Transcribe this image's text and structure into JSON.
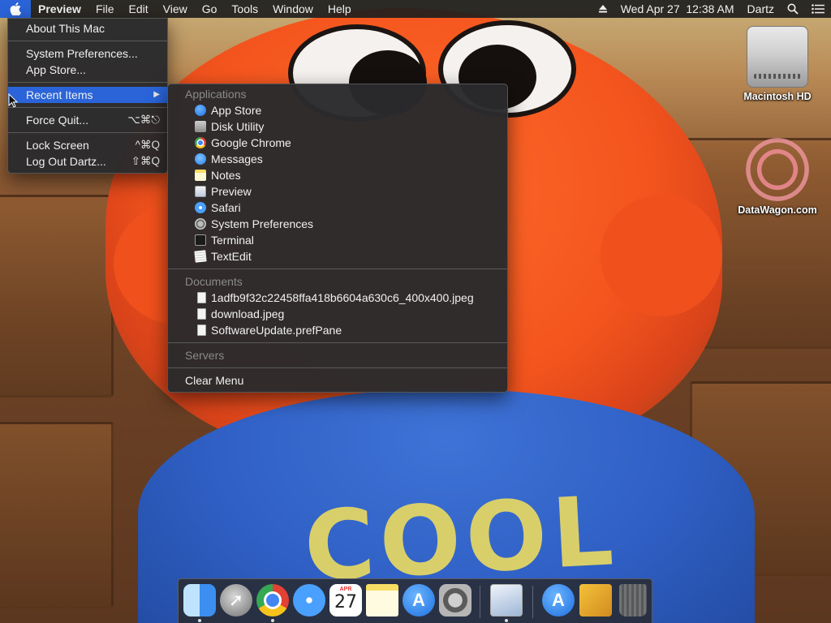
{
  "menubar": {
    "app_name": "Preview",
    "menus": [
      "File",
      "Edit",
      "View",
      "Go",
      "Tools",
      "Window",
      "Help"
    ],
    "clock": "Wed Apr 27  12:38 AM",
    "user": "Dartz"
  },
  "apple_menu": {
    "about": "About This Mac",
    "system_preferences": "System Preferences...",
    "app_store": "App Store...",
    "recent_items": "Recent Items",
    "recent_arrow": "▶",
    "force_quit": "Force Quit...",
    "force_quit_shortcut": "⌥⌘⎋",
    "lock_screen": "Lock Screen",
    "lock_screen_shortcut": "^⌘Q",
    "log_out": "Log Out Dartz...",
    "log_out_shortcut": "⇧⌘Q"
  },
  "recent_menu": {
    "applications_header": "Applications",
    "applications": [
      {
        "label": "App Store",
        "icon": "app-store-icon"
      },
      {
        "label": "Disk Utility",
        "icon": "disk-utility-icon"
      },
      {
        "label": "Google Chrome",
        "icon": "chrome-icon"
      },
      {
        "label": "Messages",
        "icon": "messages-icon"
      },
      {
        "label": "Notes",
        "icon": "notes-icon"
      },
      {
        "label": "Preview",
        "icon": "preview-icon"
      },
      {
        "label": "Safari",
        "icon": "safari-icon"
      },
      {
        "label": "System Preferences",
        "icon": "system-preferences-icon"
      },
      {
        "label": "Terminal",
        "icon": "terminal-icon"
      },
      {
        "label": "TextEdit",
        "icon": "textedit-icon"
      }
    ],
    "documents_header": "Documents",
    "documents": [
      {
        "label": "1adfb9f32c22458ffa418b6604a630c6_400x400.jpeg",
        "icon": "jpeg-document-icon"
      },
      {
        "label": "download.jpeg",
        "icon": "jpeg-document-icon"
      },
      {
        "label": "SoftwareUpdate.prefPane",
        "icon": "prefpane-document-icon"
      }
    ],
    "servers_header": "Servers",
    "clear_menu": "Clear Menu"
  },
  "desktop": {
    "hd_label": "Macintosh HD",
    "datawagon_label": "DataWagon.com"
  },
  "wallpaper": {
    "shirt_text": "COOL"
  },
  "dock": {
    "calendar_month": "APR",
    "calendar_day": "27"
  }
}
